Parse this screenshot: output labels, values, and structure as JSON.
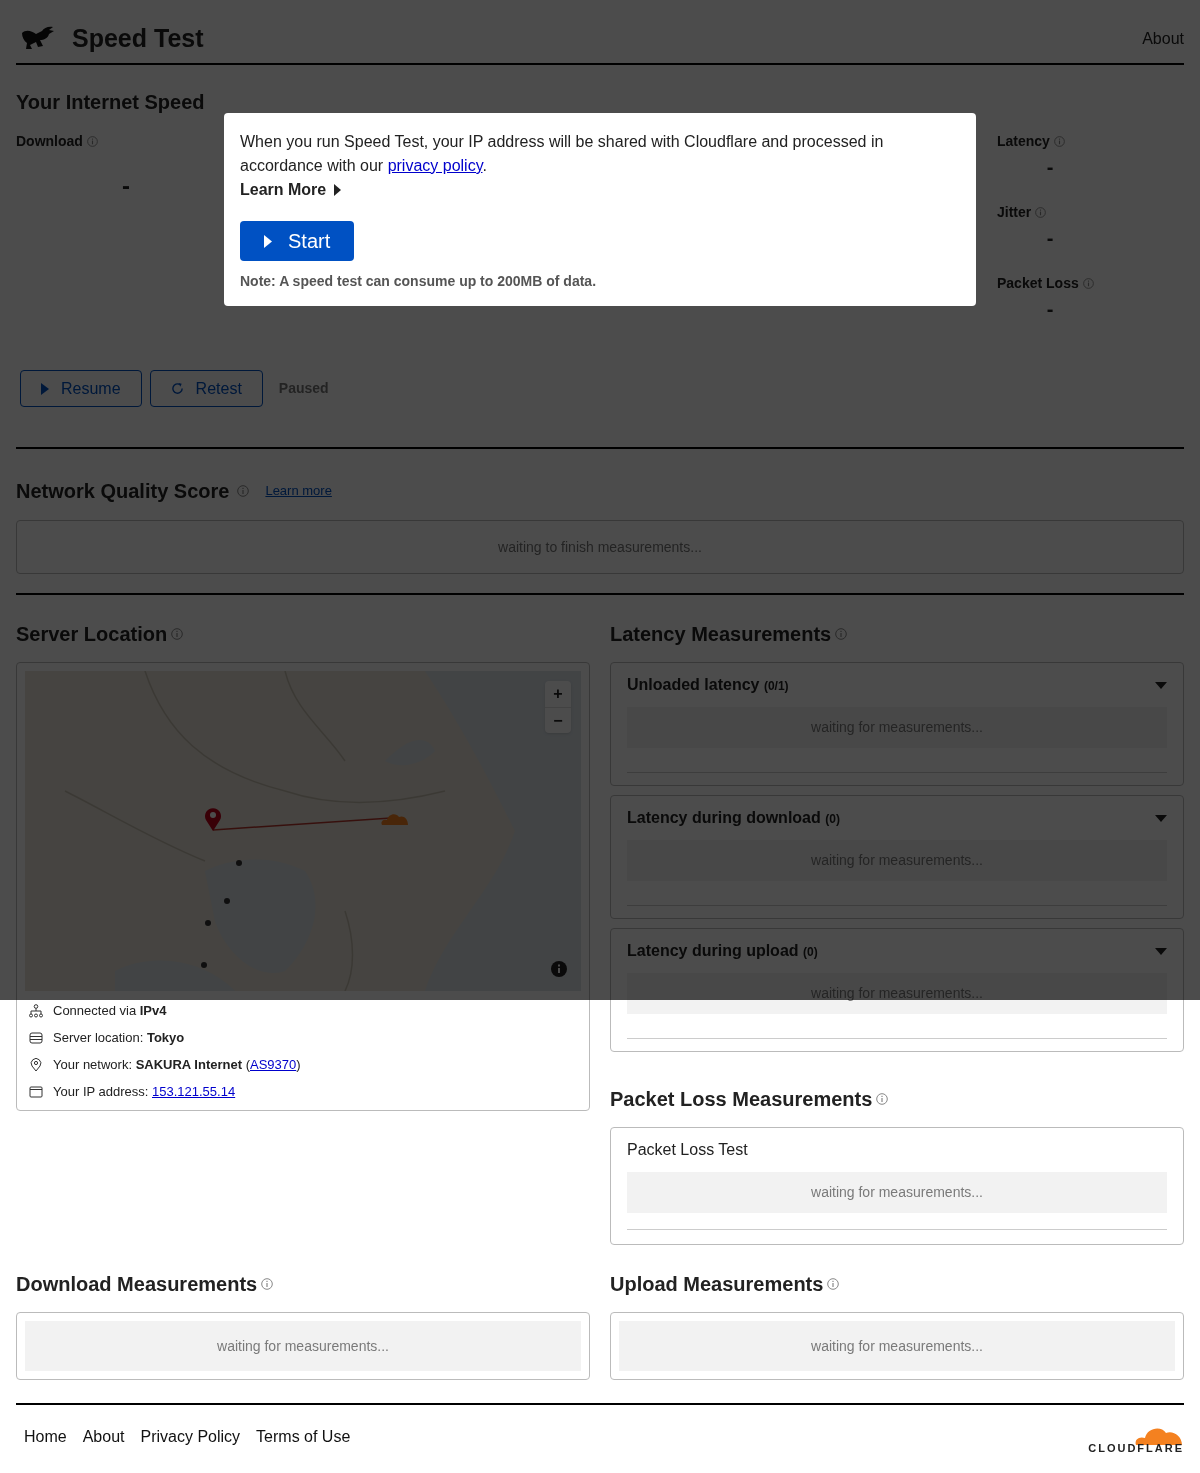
{
  "header": {
    "title": "Speed Test",
    "nav": [
      "About"
    ]
  },
  "speed": {
    "title": "Your Internet Speed",
    "download": {
      "label": "Download",
      "value": "-"
    },
    "side_metrics": [
      {
        "label": "Latency",
        "value": "-"
      },
      {
        "label": "Jitter",
        "value": "-"
      },
      {
        "label": "Packet Loss",
        "value": "-"
      }
    ],
    "buttons": [
      {
        "kind": "resume",
        "label": "Resume"
      },
      {
        "kind": "retest",
        "label": "Retest"
      }
    ],
    "status": "Paused"
  },
  "modal": {
    "text_before": "When you run Speed Test, your IP address will be shared with Cloudflare and processed in accordance with our ",
    "link": "privacy policy",
    "text_after": ".",
    "learn_more": "Learn More",
    "start": "Start",
    "note": "Note: A speed test can consume up to 200MB of data."
  },
  "quality": {
    "title": "Network Quality Score",
    "link": "Learn more",
    "placeholder": "waiting to finish measurements..."
  },
  "server": {
    "title": "Server Location",
    "map": {
      "kind": "picture",
      "zoom_in": "+",
      "zoom_out": "−"
    },
    "details": [
      {
        "kind": "connection",
        "label": "Connected via ",
        "value": "IPv4"
      },
      {
        "kind": "server",
        "label": "Server location: ",
        "value": "Tokyo"
      },
      {
        "kind": "network",
        "label": "Your network: ",
        "value": "SAKURA Internet",
        "link_open": "(",
        "link": "AS9370",
        "link_close": ")"
      },
      {
        "kind": "ip",
        "label": "Your IP address: ",
        "link": "153.121.55.14"
      }
    ]
  },
  "latency": {
    "title": "Latency Measurements",
    "panels": [
      {
        "title": "Unloaded latency",
        "count": "(0/1)",
        "placeholder": "waiting for measurements..."
      },
      {
        "title": "Latency during download",
        "count": "(0)",
        "placeholder": "waiting for measurements..."
      },
      {
        "title": "Latency during upload",
        "count": "(0)",
        "placeholder": "waiting for measurements..."
      }
    ]
  },
  "packet_loss": {
    "title": "Packet Loss Measurements",
    "panel": {
      "title": "Packet Loss Test",
      "placeholder": "waiting for measurements..."
    }
  },
  "download": {
    "title": "Download Measurements",
    "placeholder": "waiting for measurements..."
  },
  "upload": {
    "title": "Upload Measurements",
    "placeholder": "waiting for measurements..."
  },
  "footer": {
    "links": [
      "Home",
      "About",
      "Privacy Policy",
      "Terms of Use"
    ],
    "logo": "CLOUDFLARE"
  }
}
